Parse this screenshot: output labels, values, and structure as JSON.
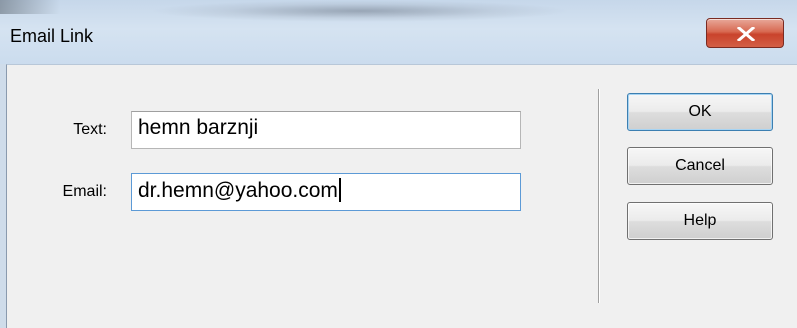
{
  "window": {
    "title": "Email Link",
    "close_icon": "close-x-icon"
  },
  "form": {
    "text_label": "Text:",
    "text_value": "hemn barznji",
    "email_label": "Email:",
    "email_value": "dr.hemn@yahoo.com"
  },
  "buttons": {
    "ok": "OK",
    "cancel": "Cancel",
    "help": "Help"
  }
}
